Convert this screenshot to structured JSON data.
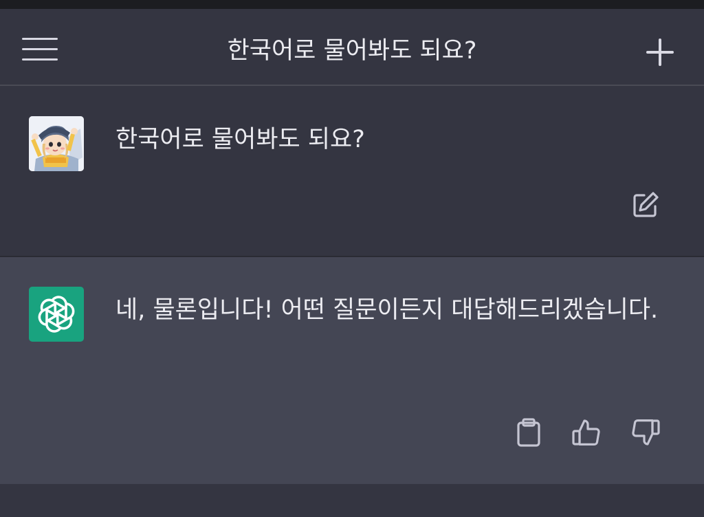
{
  "header": {
    "menu_icon": "hamburger-menu-icon",
    "title": "한국어로 물어봐도 되요?",
    "new_chat_icon": "plus-icon"
  },
  "conversation": {
    "user_message": {
      "avatar": "user-avatar-illustration",
      "text": "한국어로 물어봐도 되요?",
      "edit_icon": "edit-icon"
    },
    "assistant_message": {
      "avatar_icon": "openai-logo-icon",
      "text": "네, 물론입니다! 어떤 질문이든지 대답해드리겠습니다.",
      "actions": [
        "clipboard-icon",
        "thumbs-up-icon",
        "thumbs-down-icon"
      ]
    }
  },
  "colors": {
    "background": "#343541",
    "assistant_background": "#444654",
    "accent": "#19a37f",
    "text": "#ececf1",
    "icon": "#d9d9e3"
  }
}
